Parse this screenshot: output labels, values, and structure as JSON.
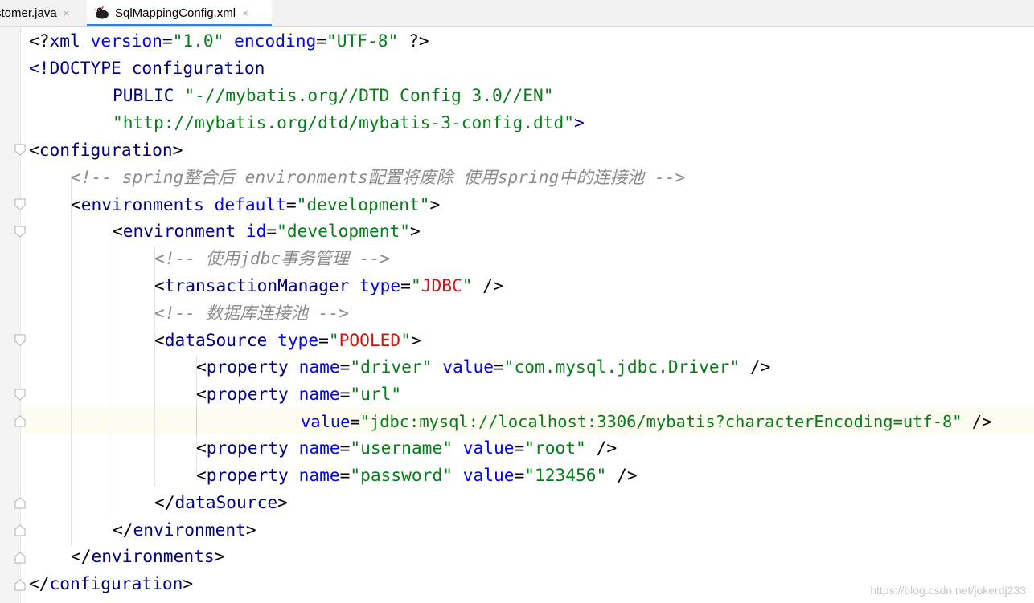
{
  "tabs": [
    {
      "label": "stomer.java",
      "close": "×",
      "active": false
    },
    {
      "label": "SqlMappingConfig.xml",
      "close": "×",
      "active": true
    }
  ],
  "code": {
    "l1": {
      "lt": "<?",
      "kw": "xml",
      "a1": "version",
      "eq1": "=",
      "v1": "\"1.0\"",
      "a2": "encoding",
      "eq2": "=",
      "v2": "\"UTF-8\"",
      "end": "?>"
    },
    "l2": {
      "lt": "<!DOCTYPE ",
      "name": "configuration"
    },
    "l3": {
      "kw": "PUBLIC",
      "v": "\"-//mybatis.org//DTD Config 3.0//EN\""
    },
    "l4": {
      "v": "\"http://mybatis.org/dtd/mybatis-3-config.dtd\"",
      "end": ">"
    },
    "l5": {
      "lt": "<",
      "tag": "configuration",
      "gt": ">"
    },
    "l6": {
      "comment": "<!-- spring整合后 environments配置将废除 使用spring中的连接池 -->"
    },
    "l7": {
      "lt": "<",
      "tag": "environments",
      "a": "default",
      "eq": "=",
      "v": "\"development\"",
      "gt": ">"
    },
    "l8": {
      "lt": "<",
      "tag": "environment",
      "a": "id",
      "eq": "=",
      "v": "\"development\"",
      "gt": ">"
    },
    "l9": {
      "comment": "<!-- 使用jdbc事务管理 -->"
    },
    "l10": {
      "lt": "<",
      "tag": "transactionManager",
      "a": "type",
      "eq": "=",
      "q1": "\"",
      "v": "JDBC",
      "q2": "\"",
      "gt": " />"
    },
    "l11": {
      "comment": "<!-- 数据库连接池 -->"
    },
    "l12": {
      "lt": "<",
      "tag": "dataSource",
      "a": "type",
      "eq": "=",
      "q1": "\"",
      "v": "POOLED",
      "q2": "\"",
      "gt": ">"
    },
    "l13": {
      "lt": "<",
      "tag": "property",
      "a1": "name",
      "eq1": "=",
      "v1": "\"driver\"",
      "a2": "value",
      "eq2": "=",
      "v2": "\"com.mysql.jdbc.Driver\"",
      "gt": " />"
    },
    "l14": {
      "lt": "<",
      "tag": "property",
      "a1": "name",
      "eq1": "=",
      "v1": "\"url\""
    },
    "l15": {
      "a": "value",
      "eq": "=",
      "v": "\"jdbc:mysql://localhost:3306/mybatis?characterEncoding=utf-8\"",
      "gt": " />"
    },
    "l16": {
      "lt": "<",
      "tag": "property",
      "a1": "name",
      "eq1": "=",
      "v1": "\"username\"",
      "a2": "value",
      "eq2": "=",
      "v2": "\"root\"",
      "gt": " />"
    },
    "l17": {
      "lt": "<",
      "tag": "property",
      "a1": "name",
      "eq1": "=",
      "v1": "\"password\"",
      "a2": "value",
      "eq2": "=",
      "v2": "\"123456\"",
      "gt": " />"
    },
    "l18": {
      "lt": "</",
      "tag": "dataSource",
      "gt": ">"
    },
    "l19": {
      "lt": "</",
      "tag": "environment",
      "gt": ">"
    },
    "l20": {
      "lt": "</",
      "tag": "environments",
      "gt": ">"
    },
    "l21": {
      "lt": "</",
      "tag": "configuration",
      "gt": ">"
    }
  },
  "watermark": "https://blog.csdn.net/jokerdj233",
  "colors": {
    "tag": "#000080",
    "attr": "#0000ff",
    "string": "#067d17",
    "keyword_value": "#c41a16",
    "comment": "#8c8c8c",
    "current_line": "#fdfcf0"
  }
}
